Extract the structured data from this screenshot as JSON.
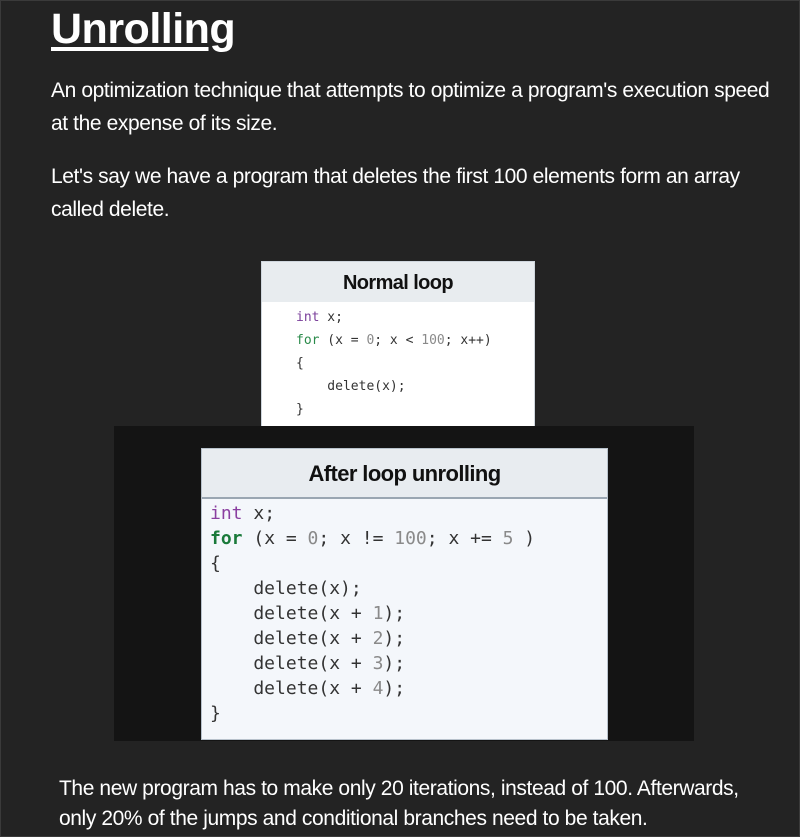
{
  "slide": {
    "title": "Unrolling",
    "para1": "An optimization technique that attempts to optimize a program's execution speed at the expense of its size.",
    "para2": "Let's say we have a program that deletes the first 100 elements form an array called delete.",
    "para3": "The new program has to make only 20 iterations, instead of 100. Afterwards, only 20% of the jumps and conditional branches need to be taken."
  },
  "normal_loop": {
    "heading": "Normal loop",
    "code": {
      "kw_int": "int",
      "decl": " x;",
      "kw_for": "for",
      "header_a": " (x = ",
      "zero": "0",
      "header_b": "; x < ",
      "hundred": "100",
      "header_c": "; x++)",
      "open": "{",
      "body": "    delete(x);",
      "close": "}"
    }
  },
  "unrolled_loop": {
    "heading": "After loop unrolling",
    "code": {
      "kw_int": "int",
      "decl": " x;",
      "kw_for": "for",
      "header_a": " (x = ",
      "zero": "0",
      "header_b": "; x != ",
      "hundred": "100",
      "header_c": "; x += ",
      "five": "5",
      "header_d": " )",
      "open": "{",
      "line1": "    delete(x);",
      "line2a": "    delete(x + ",
      "n1": "1",
      "line2b": ");",
      "line3a": "    delete(x + ",
      "n2": "2",
      "line3b": ");",
      "line4a": "    delete(x + ",
      "n3": "3",
      "line4b": ");",
      "line5a": "    delete(x + ",
      "n4": "4",
      "line5b": ");",
      "close": "}"
    }
  },
  "colors": {
    "background": "#232323",
    "text": "#ffffff",
    "keyword_type": "#8a3fa0",
    "keyword_control": "#1a7a3a"
  }
}
